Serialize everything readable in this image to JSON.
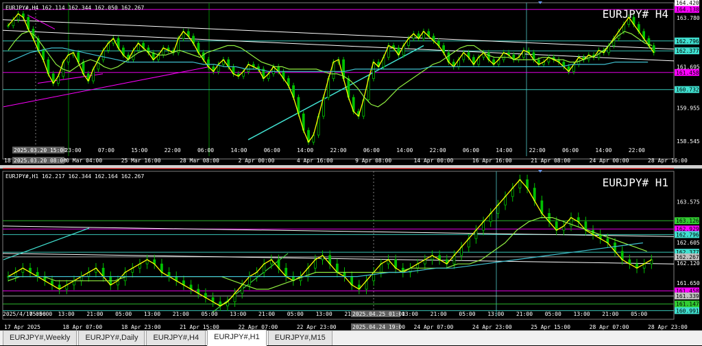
{
  "tabs": [
    {
      "label": "EURJPY#,Weekly",
      "active": false
    },
    {
      "label": "EURJPY#,Daily",
      "active": false
    },
    {
      "label": "EURJPY#,H4",
      "active": false
    },
    {
      "label": "EURJPY#,H1",
      "active": true
    },
    {
      "label": "EURJPY#,M15",
      "active": false
    }
  ],
  "chart_data": [
    {
      "type": "candlestick",
      "info": "EURJPY#,H4  162.114 162.344 162.050 162.267",
      "watermark": "EURJPY#  H4",
      "ylim": [
        157.9,
        164.42
      ],
      "price_labels": [
        "163.780",
        "162.796",
        "162.377",
        "161.695",
        "160.732",
        "159.955",
        "158.545"
      ],
      "price_markers": [
        {
          "price": 164.42,
          "text": "164.420",
          "bg": "#ffffff",
          "fg": "#000000"
        },
        {
          "price": 164.138,
          "text": "164.138",
          "bg": "#ff00ff",
          "fg": "#000000"
        },
        {
          "price": 162.796,
          "text": "162.796",
          "bg": "#40e0d0",
          "fg": "#000000"
        },
        {
          "price": 162.377,
          "text": "162.377",
          "bg": "#40e0d0",
          "fg": "#000000"
        },
        {
          "price": 161.458,
          "text": "161.458",
          "bg": "#ff00ff",
          "fg": "#000000"
        },
        {
          "price": 160.732,
          "text": "160.732",
          "bg": "#40e0d0",
          "fg": "#000000"
        }
      ],
      "time_labels": [
        "18 Mar 2025",
        "20 Mar 04:00",
        "25 Mar 16:00",
        "28 Mar 08:00",
        "2 Apr 00:00",
        "4 Apr 16:00",
        "9 Apr 08:00",
        "14 Apr 00:00",
        "16 Apr 16:00",
        "21 Apr 08:00",
        "24 Apr 00:00",
        "28 Apr 16:00"
      ],
      "hour_labels": [
        "15:00",
        "23:00",
        "07:00",
        "15:00",
        "22:00",
        "06:00",
        "14:00",
        "06:00",
        "14:00",
        "22:00",
        "06:00",
        "14:00",
        "22:00",
        "06:00",
        "14:00",
        "22:00",
        "06:00",
        "14:00",
        "22:00"
      ],
      "crosshair_labels": [
        "2025.03.20 15:00",
        "2025.03.20 08:00"
      ],
      "series": [
        {
          "name": "close",
          "values": [
            163.45,
            163.7,
            163.95,
            163.8,
            163.3,
            162.9,
            162.4,
            162.0,
            161.4,
            161.0,
            161.3,
            161.9,
            162.2,
            162.3,
            161.9,
            161.4,
            161.1,
            161.6,
            162.0,
            162.4,
            162.7,
            162.9,
            162.5,
            162.2,
            162.0,
            162.4,
            162.7,
            162.5,
            162.3,
            162.0,
            162.2,
            162.5,
            162.4,
            162.3,
            162.9,
            163.2,
            163.0,
            162.7,
            162.3,
            162.0,
            161.7,
            161.5,
            161.8,
            162.0,
            161.7,
            161.4,
            161.3,
            161.5,
            161.8,
            161.7,
            161.6,
            161.2,
            161.4,
            161.7,
            161.5,
            161.2,
            160.9,
            160.4,
            159.7,
            159.0,
            158.5,
            158.8,
            159.6,
            160.4,
            161.2,
            161.9,
            162.0,
            161.2,
            160.4,
            159.8,
            159.6,
            160.3,
            161.2,
            161.9,
            161.7,
            162.1,
            162.6,
            162.5,
            162.2,
            162.6,
            162.9,
            163.1,
            162.9,
            163.2,
            163.0,
            162.8,
            162.6,
            162.3,
            161.9,
            161.7,
            162.0,
            162.3,
            162.1,
            161.8,
            162.1,
            162.3,
            162.0,
            161.8,
            162.0,
            162.3,
            162.2,
            162.0,
            162.1,
            162.4,
            162.3,
            162.0,
            161.8,
            161.9,
            162.1,
            162.0,
            161.9,
            161.7,
            161.5,
            161.8,
            162.1,
            162.0,
            162.2,
            162.1,
            162.4,
            162.3,
            162.6,
            162.9,
            163.2,
            163.5,
            163.8,
            163.5,
            163.2,
            162.9,
            162.6,
            162.3
          ]
        },
        {
          "name": "ma_fast",
          "values": [
            162.4,
            162.8,
            163.1,
            163.2,
            163.0,
            162.6,
            162.2,
            161.8,
            161.6,
            161.5,
            161.7,
            161.9,
            162.0,
            161.9,
            161.7,
            161.6,
            161.7,
            161.9,
            162.1,
            162.3,
            162.4,
            162.3,
            162.2,
            162.2,
            162.3,
            162.4,
            162.3,
            162.2,
            162.1,
            162.3,
            162.4,
            162.5,
            162.6,
            162.6,
            162.5,
            162.3,
            162.1,
            161.9,
            161.8,
            161.7,
            161.7,
            161.6,
            161.6,
            161.6,
            161.6,
            161.6,
            161.5,
            161.4,
            161.4,
            161.3,
            161.1,
            160.8,
            160.4,
            160.1,
            160.0,
            160.2,
            160.5,
            160.8,
            161.0,
            161.2,
            161.4,
            161.6,
            161.8,
            161.9,
            162.1,
            162.3,
            162.5,
            162.6,
            162.6,
            162.4,
            162.2,
            162.1,
            162.1,
            162.1,
            162.0,
            162.0,
            162.0,
            162.0,
            162.1,
            162.1,
            162.0,
            162.0,
            161.9,
            161.9,
            162.0,
            162.1,
            162.2,
            162.4,
            162.7,
            163.0,
            163.2,
            163.1,
            162.9,
            162.7,
            162.6
          ]
        },
        {
          "name": "ma_slow",
          "values": [
            161.9,
            162.1,
            162.3,
            162.4,
            162.5,
            162.5,
            162.4,
            162.3,
            162.2,
            162.1,
            162.0,
            161.9,
            161.9,
            161.9,
            161.9,
            161.9,
            161.9,
            161.9,
            161.8,
            161.8,
            161.7,
            161.7,
            161.6,
            161.6,
            161.5,
            161.5,
            161.5,
            161.5,
            161.5,
            161.5,
            161.5,
            161.5,
            161.6,
            161.6,
            161.6,
            161.6,
            161.6,
            161.6,
            161.6,
            161.7,
            161.7,
            161.7,
            161.7,
            161.7,
            161.7,
            161.7,
            161.7,
            161.7,
            161.7,
            161.7,
            161.7,
            161.7,
            161.8,
            161.8,
            161.8,
            161.8,
            161.9,
            161.9,
            161.9,
            161.9
          ]
        }
      ]
    },
    {
      "type": "candlestick",
      "info": "EURJPY#,H1  162.217 162.344 162.164 162.267",
      "watermark": "EURJPY#  H1",
      "ylim": [
        160.85,
        164.3
      ],
      "price_labels": [
        "163.575",
        "162.605",
        "162.120",
        "161.650"
      ],
      "price_markers": [
        {
          "price": 163.126,
          "text": "163.126",
          "bg": "#32cd32",
          "fg": "#000000"
        },
        {
          "price": 162.929,
          "text": "162.929",
          "bg": "#ff00ff",
          "fg": "#000000"
        },
        {
          "price": 162.796,
          "text": "162.796",
          "bg": "#40e0d0",
          "fg": "#000000"
        },
        {
          "price": 162.377,
          "text": "162.377",
          "bg": "#40e0d0",
          "fg": "#000000"
        },
        {
          "price": 162.267,
          "text": "162.267",
          "bg": "#c0c0c0",
          "fg": "#000000"
        },
        {
          "price": 161.458,
          "text": "161.458",
          "bg": "#ff00ff",
          "fg": "#000000"
        },
        {
          "price": 161.339,
          "text": "161.339",
          "bg": "#c0c0c0",
          "fg": "#000000"
        },
        {
          "price": 161.147,
          "text": "161.147",
          "bg": "#32cd32",
          "fg": "#000000"
        },
        {
          "price": 160.991,
          "text": "160.991",
          "bg": "#40e0d0",
          "fg": "#000000"
        }
      ],
      "time_labels": [
        "17 Apr 2025",
        "18 Apr 07:00",
        "18 Apr 23:00",
        "21 Apr 15:00",
        "22 Apr 07:00",
        "22 Apr 23:00",
        "23 Apr 15:00",
        "24 Apr 07:00",
        "24 Apr 23:00",
        "25 Apr 15:00",
        "28 Apr 07:00",
        "28 Apr 23:00"
      ],
      "hour_labels": [
        "05:00",
        "13:00",
        "21:00",
        "05:00",
        "13:00",
        "21:00",
        "05:00",
        "13:00",
        "21:00",
        "05:00",
        "13:00",
        "21:00",
        "05:00",
        "13:00",
        "21:00",
        "05:00",
        "13:00",
        "21:00",
        "05:00",
        "13:00",
        "21:00",
        "05:00"
      ],
      "crosshair_labels": [
        "2025/4/17 05:00",
        "2025.04.25 01:00",
        "2025.04.24 19:00"
      ],
      "series": [
        {
          "name": "close",
          "values": [
            161.8,
            161.9,
            162.0,
            161.9,
            161.8,
            161.7,
            161.6,
            161.5,
            161.6,
            161.7,
            161.8,
            161.9,
            162.0,
            161.8,
            161.6,
            161.7,
            161.9,
            162.0,
            162.1,
            162.2,
            162.1,
            161.9,
            161.8,
            161.7,
            161.6,
            161.5,
            161.4,
            161.3,
            161.2,
            161.1,
            161.2,
            161.4,
            161.6,
            161.8,
            161.9,
            162.1,
            162.2,
            162.0,
            161.8,
            161.7,
            161.8,
            162.0,
            162.2,
            162.3,
            162.1,
            161.9,
            161.8,
            161.6,
            161.5,
            161.7,
            161.9,
            162.1,
            162.2,
            162.0,
            161.9,
            162.0,
            162.1,
            162.2,
            162.3,
            162.2,
            162.1,
            162.3,
            162.5,
            162.7,
            162.9,
            163.1,
            163.3,
            163.5,
            163.7,
            163.9,
            164.1,
            163.9,
            163.6,
            163.3,
            163.1,
            162.9,
            163.0,
            163.2,
            163.1,
            162.9,
            162.8,
            162.7,
            162.6,
            162.4,
            162.2,
            162.1,
            162.0,
            162.1,
            162.2
          ]
        },
        {
          "name": "ma_fast",
          "values": [
            161.7,
            161.8,
            161.8,
            161.8,
            161.7,
            161.7,
            161.7,
            161.7,
            161.7,
            161.7,
            161.8,
            161.8,
            161.8,
            161.8,
            161.8,
            161.8,
            161.8,
            161.8,
            161.8,
            161.7,
            161.6,
            161.5,
            161.5,
            161.6,
            161.7,
            161.8,
            161.9,
            161.9,
            161.9,
            161.9,
            161.9,
            161.9,
            161.9,
            161.9,
            162.0,
            162.0,
            162.0,
            162.0,
            162.1,
            162.1,
            162.2,
            162.4,
            162.6,
            162.9,
            163.1,
            163.2,
            163.2,
            163.1,
            163.0,
            162.9,
            162.8,
            162.7,
            162.6,
            162.5,
            162.4
          ]
        },
        {
          "name": "ma_slow",
          "values": [
            161.8,
            161.8,
            161.8,
            161.8,
            161.8,
            161.8,
            161.8,
            161.8,
            161.8,
            161.8,
            161.8,
            161.8,
            161.8,
            161.8,
            161.8,
            161.8,
            161.8,
            161.8,
            161.8,
            161.8,
            161.8,
            161.8,
            161.8,
            161.85,
            161.9,
            161.9,
            161.95,
            162.0,
            162.0,
            162.05,
            162.1,
            162.15,
            162.2,
            162.25,
            162.3,
            162.35,
            162.4,
            162.45,
            162.5,
            162.55,
            162.6
          ]
        }
      ]
    }
  ],
  "colors": {
    "bg": "#000000",
    "candle": "#00c000",
    "close": "#ffff00",
    "ma_fast": "#90ee40",
    "ma_slow": "#40c0d0",
    "magenta": "#ff00ff",
    "trend": "#ffffff",
    "cyan": "#40e0d0"
  }
}
